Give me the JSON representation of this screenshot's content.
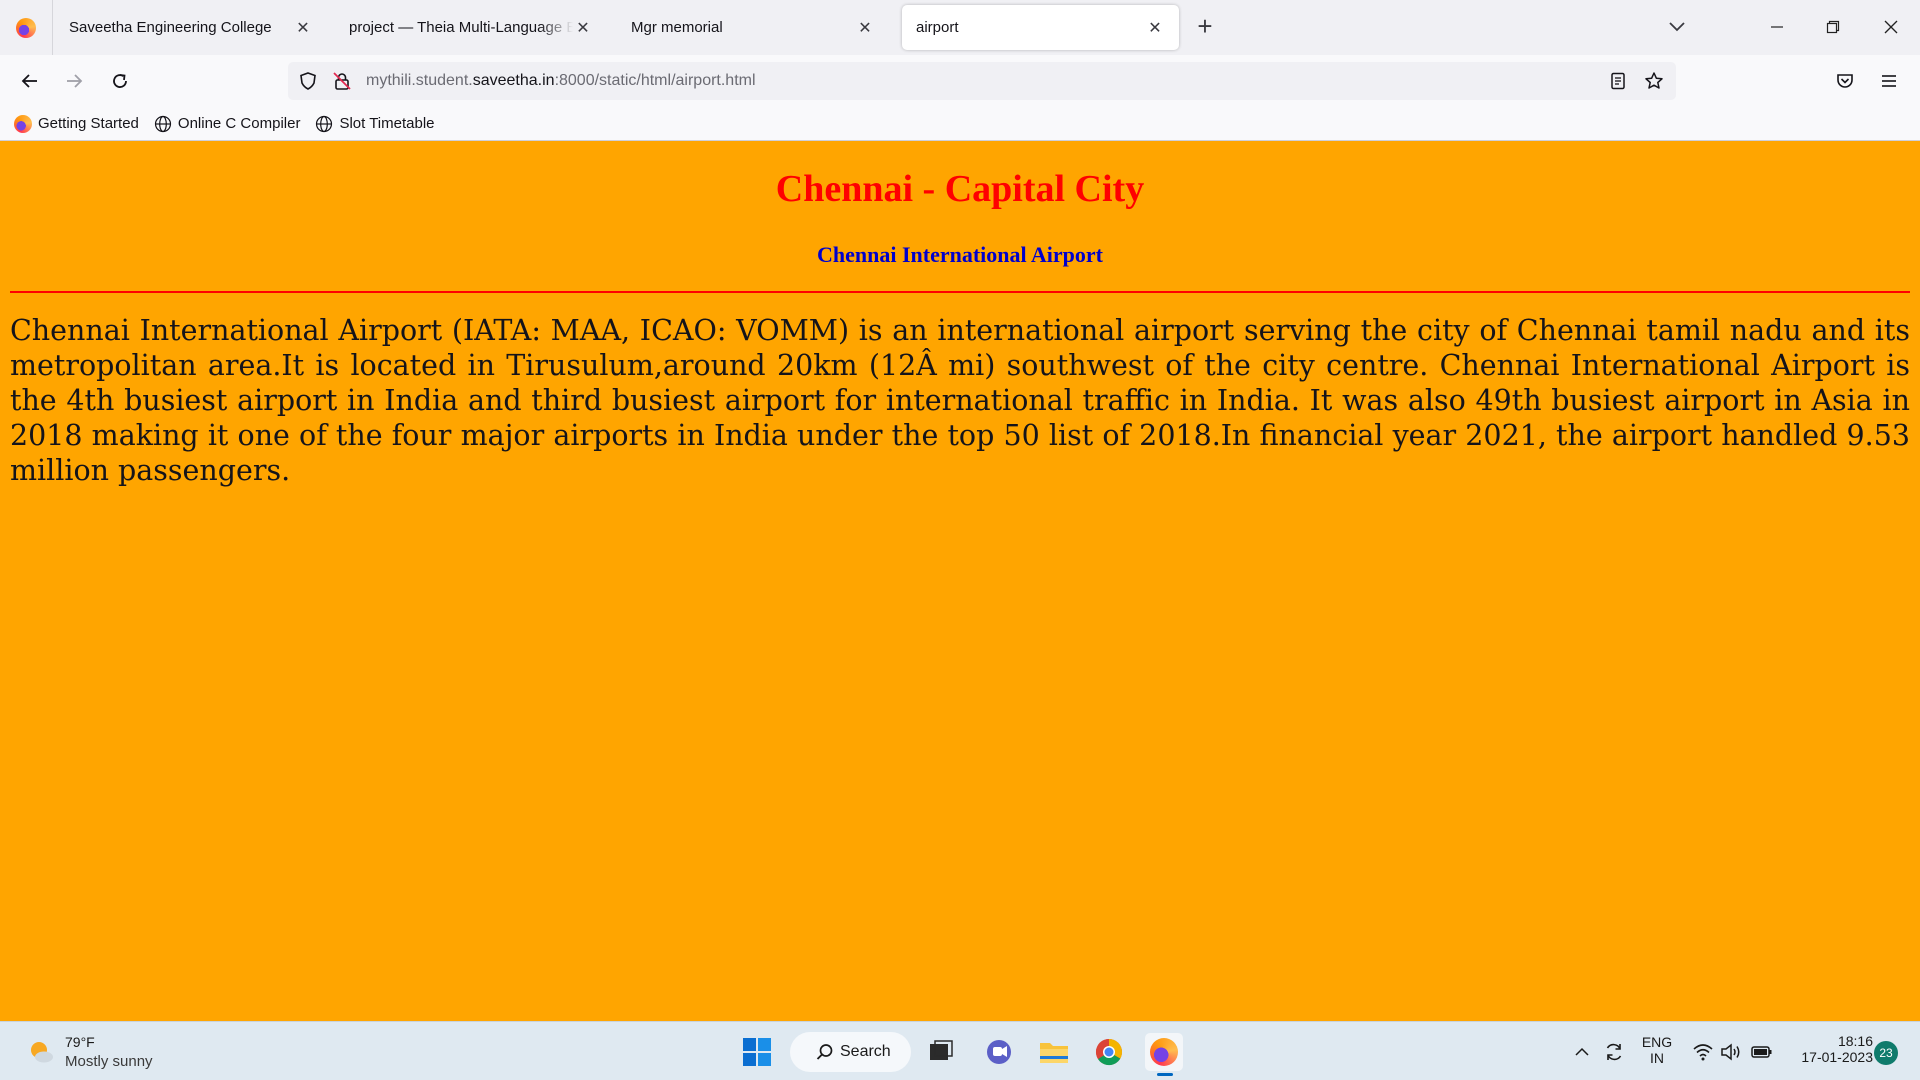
{
  "browser": {
    "tabs": [
      {
        "title": "Saveetha Engineering College",
        "active": false
      },
      {
        "title": "project — Theia Multi-Language Explorer",
        "active": false
      },
      {
        "title": "Mgr memorial",
        "active": false
      },
      {
        "title": "airport",
        "active": true
      }
    ],
    "url": {
      "prefix": "mythili.student.",
      "domain": "saveetha.in",
      "suffix": ":8000/static/html/airport.html"
    },
    "bookmarks": [
      {
        "label": "Getting Started",
        "icon": "firefox-icon"
      },
      {
        "label": "Online C Compiler",
        "icon": "globe-icon"
      },
      {
        "label": "Slot Timetable",
        "icon": "globe-icon"
      }
    ]
  },
  "page": {
    "background": "#ffa500",
    "title": "Chennai - Capital City",
    "title_color": "#ff0000",
    "subtitle": "Chennai International Airport",
    "subtitle_color": "#0000cd",
    "body": "Chennai International Airport (IATA: MAA, ICAO: VOMM) is an international airport serving the city of Chennai tamil nadu and its metropolitan area.It is located in Tirusulum,around 20km (12Â mi) southwest of the city centre. Chennai International Airport is the 4th busiest airport in India and third busiest airport for international traffic in India. It was also 49th busiest airport in Asia in 2018 making it one of the four major airports in India under the top 50 list of 2018.In financial year 2021, the airport handled 9.53 million passengers."
  },
  "taskbar": {
    "weather": {
      "temp": "79°F",
      "desc": "Mostly sunny"
    },
    "search_label": "Search",
    "language": {
      "line1": "ENG",
      "line2": "IN"
    },
    "time": "18:16",
    "date": "17-01-2023",
    "notifications": "23"
  }
}
